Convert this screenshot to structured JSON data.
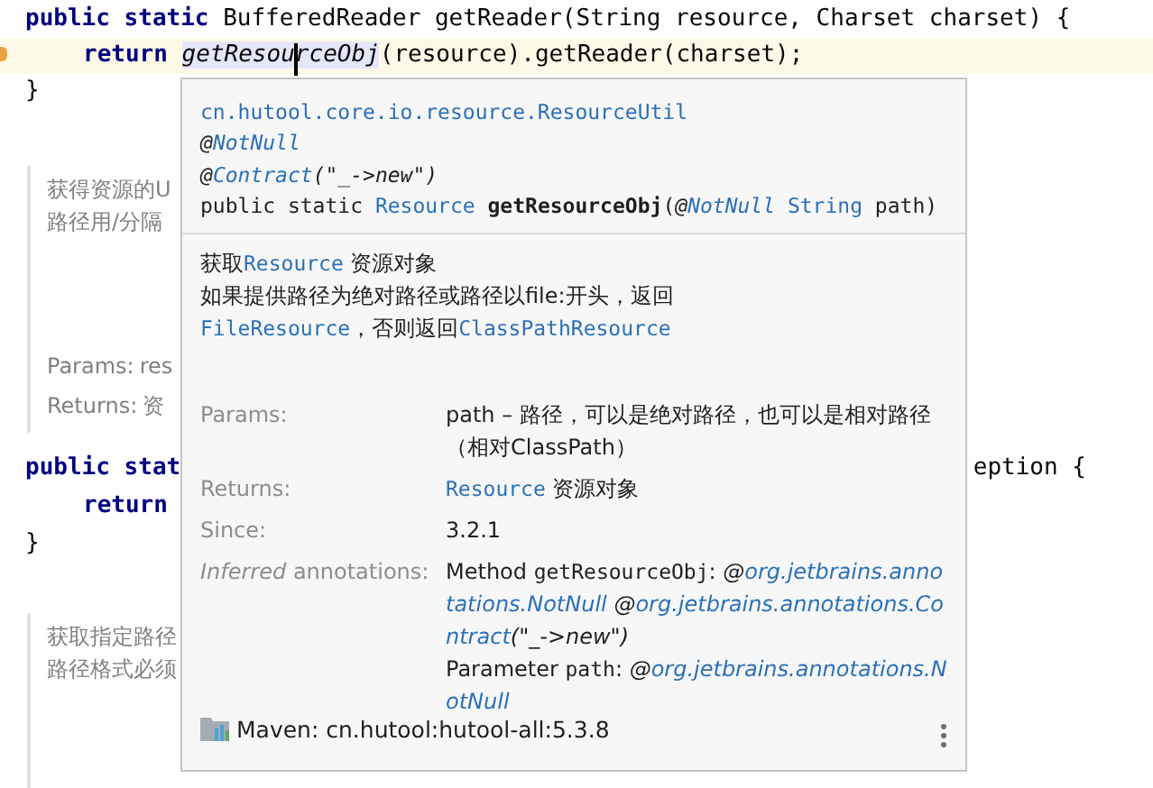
{
  "editor": {
    "code_top": [
      {
        "current": false,
        "indent": false,
        "segments": [
          {
            "text": "public static",
            "kind": "keyword"
          },
          {
            "text": " BufferedReader getReader(String resource, Charset charset) {",
            "kind": "plain"
          }
        ]
      },
      {
        "current": true,
        "indent": true,
        "segments": [
          {
            "text": "return ",
            "kind": "keyword"
          },
          {
            "text": "getResourceObj",
            "kind": "call"
          },
          {
            "text": "(resource).getReader(charset);",
            "kind": "plain"
          }
        ]
      },
      {
        "current": false,
        "indent": false,
        "segments": [
          {
            "text": "}",
            "kind": "plain"
          }
        ]
      }
    ],
    "doc_top": {
      "lines": [
        "获得资源的U",
        "路径用/分隔"
      ],
      "tags": [
        {
          "label": "Params:",
          "value": "res"
        },
        {
          "label": "Returns:",
          "value": "资"
        }
      ]
    },
    "code_bottom": [
      {
        "left": "public stat",
        "right": "eption {",
        "kind": "declaration"
      },
      {
        "left": "return",
        "kind": "statement"
      },
      {
        "left": "}",
        "kind": "brace"
      }
    ],
    "doc_bottom": {
      "lines": [
        "获取指定路径",
        "路径格式必须"
      ]
    }
  },
  "popup": {
    "signature": [
      [
        {
          "text": "cn.hutool.core.io.resource.ResourceUtil",
          "kind": "type"
        }
      ],
      [
        {
          "text": "@",
          "kind": "at"
        },
        {
          "text": "NotNull",
          "kind": "anno"
        }
      ],
      [
        {
          "text": "@",
          "kind": "at"
        },
        {
          "text": "Contract",
          "kind": "anno"
        },
        {
          "text": "(\"_->new\")",
          "kind": "at"
        }
      ],
      [
        {
          "text": "public static ",
          "kind": "plain"
        },
        {
          "text": "Resource ",
          "kind": "type"
        },
        {
          "text": "getResourceObj",
          "kind": "name"
        },
        {
          "text": "(",
          "kind": "plain"
        },
        {
          "text": "@",
          "kind": "at"
        },
        {
          "text": "NotNull ",
          "kind": "anno"
        },
        {
          "text": "String",
          "kind": "type"
        },
        {
          "text": " path)",
          "kind": "plain"
        }
      ]
    ],
    "description": [
      [
        {
          "text": "获取",
          "kind": "plain"
        },
        {
          "text": "Resource",
          "kind": "type"
        },
        {
          "text": " 资源对象",
          "kind": "plain"
        }
      ],
      [
        {
          "text": "如果提供路径为绝对路径或路径以file:开头，返回",
          "kind": "plain"
        },
        {
          "text": "FileResource",
          "kind": "type"
        },
        {
          "text": "，否则返回",
          "kind": "plain"
        },
        {
          "text": "ClassPathResource",
          "kind": "type"
        }
      ]
    ],
    "sections": [
      {
        "label": [
          {
            "text": "Params:",
            "kind": "plain"
          }
        ],
        "values": [
          [
            {
              "text": "path – 路径，可以是绝对路径，也可以是相对路径（相对ClassPath）",
              "kind": "plain"
            }
          ]
        ]
      },
      {
        "label": [
          {
            "text": "Returns:",
            "kind": "plain"
          }
        ],
        "values": [
          [
            {
              "text": "Resource",
              "kind": "type"
            },
            {
              "text": " 资源对象",
              "kind": "plain"
            }
          ]
        ]
      },
      {
        "label": [
          {
            "text": "Since:",
            "kind": "plain"
          }
        ],
        "values": [
          [
            {
              "text": "3.2.1",
              "kind": "plain"
            }
          ]
        ]
      },
      {
        "label": [
          {
            "text": "Inferred",
            "kind": "at"
          },
          {
            "text": " annotations:",
            "kind": "plain"
          }
        ],
        "values": [
          [
            {
              "text": "Method ",
              "kind": "plain"
            },
            {
              "text": "getResourceObj",
              "kind": "mono"
            },
            {
              "text": ": ",
              "kind": "plain"
            },
            {
              "text": "@",
              "kind": "at"
            },
            {
              "text": "org.jetbrains.annotations.NotNull ",
              "kind": "anno"
            },
            {
              "text": "@",
              "kind": "at"
            },
            {
              "text": "org.jetbrains.annotations.Contract",
              "kind": "anno"
            },
            {
              "text": "(\"_->new\")",
              "kind": "at"
            }
          ],
          [
            {
              "text": "Parameter ",
              "kind": "plain"
            },
            {
              "text": "path",
              "kind": "mono"
            },
            {
              "text": ": ",
              "kind": "plain"
            },
            {
              "text": "@",
              "kind": "at"
            },
            {
              "text": "org.jetbrains.annotations.NotNull",
              "kind": "anno"
            }
          ]
        ]
      }
    ],
    "footer": {
      "library": "Maven: cn.hutool:hutool-all:5.3.8"
    }
  }
}
